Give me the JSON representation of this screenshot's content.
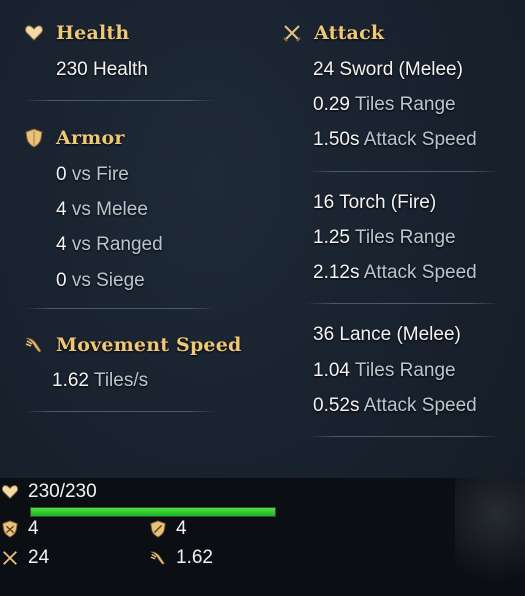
{
  "health": {
    "heading": "Health",
    "value": "230 Health"
  },
  "armor": {
    "heading": "Armor",
    "lines": [
      {
        "num": "0",
        "text": "vs Fire"
      },
      {
        "num": "4",
        "text": "vs Melee"
      },
      {
        "num": "4",
        "text": "vs Ranged"
      },
      {
        "num": "0",
        "text": "vs Siege"
      }
    ]
  },
  "movement": {
    "heading": "Movement Speed",
    "num": "1.62",
    "text": "Tiles/s"
  },
  "attack": {
    "heading": "Attack",
    "weapons": [
      {
        "title": "24 Sword  (Melee)",
        "range_num": "0.29",
        "range_text": "Tiles Range",
        "speed_num": "1.50s",
        "speed_text": "Attack Speed"
      },
      {
        "title": "16 Torch  (Fire)",
        "range_num": "1.25",
        "range_text": "Tiles Range",
        "speed_num": "2.12s",
        "speed_text": "Attack Speed"
      },
      {
        "title": "36 Lance  (Melee)",
        "range_num": "1.04",
        "range_text": "Tiles Range",
        "speed_num": "0.52s",
        "speed_text": "Attack Speed"
      }
    ]
  },
  "summary": {
    "health": "230/230",
    "health_fraction": 1.0,
    "armor_melee": "4",
    "armor_ranged": "4",
    "attack": "24",
    "movement": "1.62"
  },
  "colors": {
    "heading": "#f0c774",
    "health_bar": "#2fd02f",
    "background": "#18212d"
  },
  "icons": {
    "health": "heart-icon",
    "armor": "shield-icon",
    "movement": "winged-boot-icon",
    "attack": "crossed-swords-icon"
  }
}
